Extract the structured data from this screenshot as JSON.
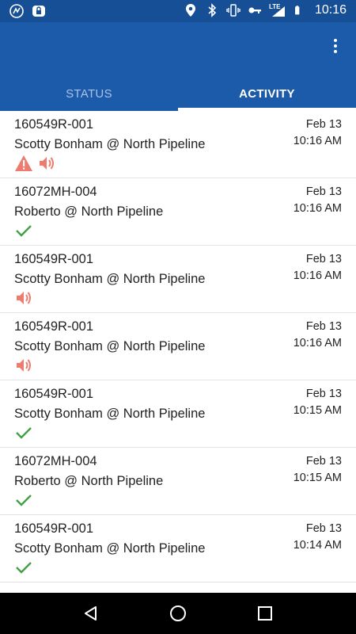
{
  "status_bar": {
    "time": "10:16",
    "left_icons": [
      "app-notification-icon",
      "lock-notification-icon"
    ],
    "right_icons": [
      "location-icon",
      "bluetooth-icon",
      "vibrate-icon",
      "key-icon",
      "lte-signal-icon",
      "battery-icon"
    ],
    "network": "LTE"
  },
  "app_bar": {
    "overflow_icon": "more-vert-icon"
  },
  "tabs": [
    {
      "label": "STATUS",
      "active": false
    },
    {
      "label": "ACTIVITY",
      "active": true
    }
  ],
  "activity": [
    {
      "title": "160549R-001",
      "subtitle": "Scotty Bonham @ North Pipeline",
      "date": "Feb 13",
      "time": "10:16 AM",
      "icons": [
        "warning-icon",
        "speaker-icon"
      ]
    },
    {
      "title": "16072MH-004",
      "subtitle": "Roberto @ North Pipeline",
      "date": "Feb 13",
      "time": "10:16 AM",
      "icons": [
        "check-icon"
      ]
    },
    {
      "title": "160549R-001",
      "subtitle": "Scotty Bonham @ North Pipeline",
      "date": "Feb 13",
      "time": "10:16 AM",
      "icons": [
        "speaker-icon"
      ]
    },
    {
      "title": "160549R-001",
      "subtitle": "Scotty Bonham @ North Pipeline",
      "date": "Feb 13",
      "time": "10:16 AM",
      "icons": [
        "speaker-icon"
      ]
    },
    {
      "title": "160549R-001",
      "subtitle": "Scotty Bonham @ North Pipeline",
      "date": "Feb 13",
      "time": "10:15 AM",
      "icons": [
        "check-icon"
      ]
    },
    {
      "title": "16072MH-004",
      "subtitle": "Roberto @ North Pipeline",
      "date": "Feb 13",
      "time": "10:15 AM",
      "icons": [
        "check-icon"
      ]
    },
    {
      "title": "160549R-001",
      "subtitle": "Scotty Bonham @ North Pipeline",
      "date": "Feb 13",
      "time": "10:14 AM",
      "icons": [
        "check-icon"
      ]
    }
  ],
  "colors": {
    "status_bar": "#174f96",
    "app_bar": "#1c5aaa",
    "alert": "#ef7b6e",
    "success": "#43a047"
  },
  "nav_bar": {
    "buttons": [
      "back-icon",
      "home-icon",
      "recents-icon"
    ]
  }
}
